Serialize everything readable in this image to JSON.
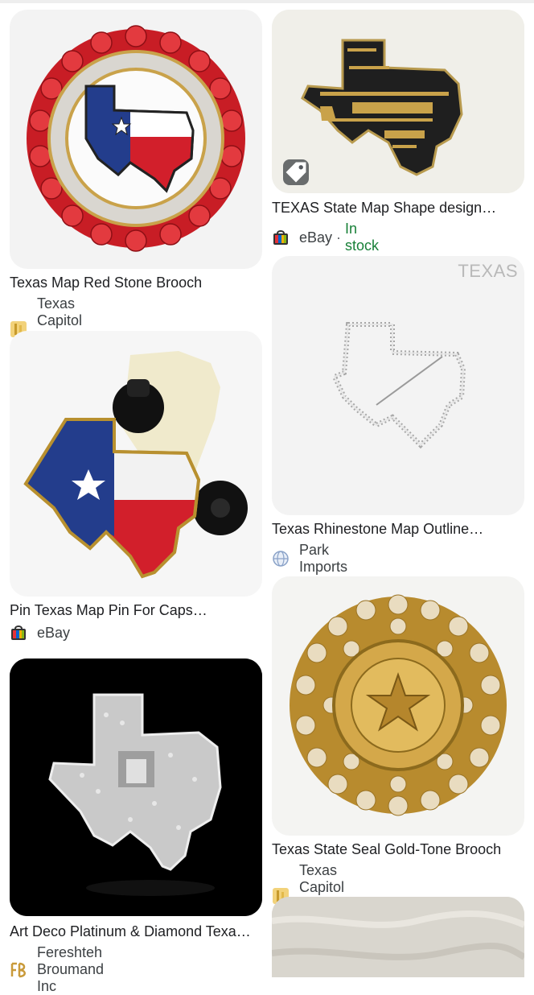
{
  "results": [
    {
      "title": "Texas Map Red Stone Brooch",
      "source": "Texas Capitol Gift Shop",
      "favicon": "gift-shop-icon"
    },
    {
      "title": "TEXAS State Map Shape design…",
      "source": "eBay",
      "stock": "In stock",
      "favicon": "ebay-bag-icon"
    },
    {
      "title": "Texas Rhinestone Map Outline…",
      "source": "Park Imports",
      "favicon": "globe-icon",
      "watermark": "TEXAS"
    },
    {
      "title": "Pin Texas Map Pin For Caps…",
      "source": "eBay",
      "favicon": "ebay-bag-icon"
    },
    {
      "title": "Texas State Seal Gold-Tone Brooch",
      "source": "Texas Capitol Gift Shop",
      "favicon": "gift-shop-icon"
    },
    {
      "title": "Art Deco Platinum & Diamond Texa…",
      "source": "Fereshteh Broumand Inc",
      "favicon": "fb-logo-icon"
    }
  ],
  "colors": {
    "in_stock": "#188038",
    "red": "#d21f2b",
    "blue": "#233d8c",
    "gold": "#c9a24a"
  }
}
